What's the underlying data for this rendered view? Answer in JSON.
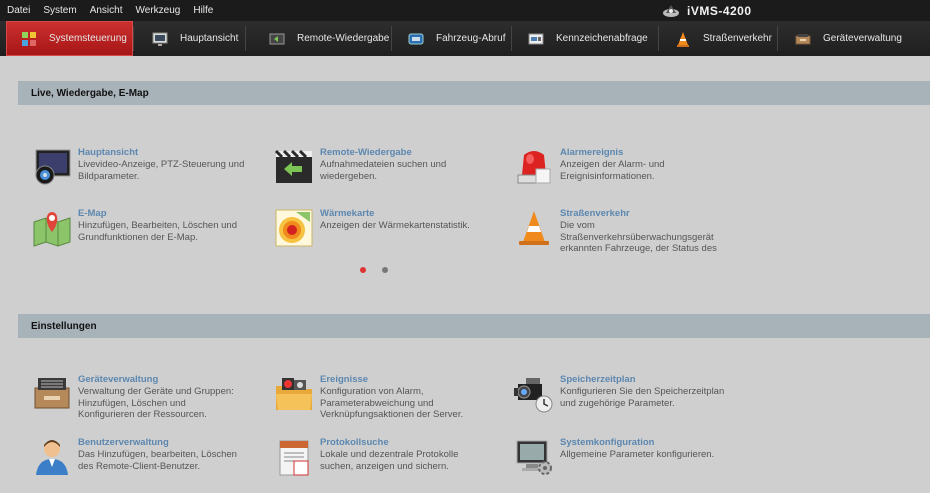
{
  "menubar": {
    "items": [
      "Datei",
      "System",
      "Ansicht",
      "Werkzeug",
      "Hilfe"
    ],
    "app_title": "iVMS-4200"
  },
  "tabs": [
    {
      "label": "Systemsteuerung",
      "icon": "grid-icon",
      "active": true
    },
    {
      "label": "Hauptansicht",
      "icon": "monitor-icon",
      "active": false
    },
    {
      "label": "Remote-Wiedergabe",
      "icon": "playback-icon",
      "active": false
    },
    {
      "label": "Fahrzeug-Abruf",
      "icon": "car-icon",
      "active": false
    },
    {
      "label": "Kennzeichenabfrage",
      "icon": "license-plate-icon",
      "active": false
    },
    {
      "label": "Straßenverkehr",
      "icon": "traffic-cone-icon",
      "active": false
    },
    {
      "label": "Geräteverwaltung",
      "icon": "device-icon",
      "active": false
    }
  ],
  "sections": {
    "live": {
      "header": "Live, Wiedergabe, E-Map",
      "items": [
        {
          "title": "Hauptansicht",
          "desc": [
            "Livevideo-Anzeige, PTZ-Steuerung und",
            "Bildparameter."
          ],
          "icon": "main-view-icon"
        },
        {
          "title": "Remote-Wiedergabe",
          "desc": [
            "Aufnahmedateien suchen und",
            "wiedergeben."
          ],
          "icon": "remote-playback-icon"
        },
        {
          "title": "Alarmereignis",
          "desc": [
            "Anzeigen der Alarm- und",
            "Ereignisinformationen."
          ],
          "icon": "alarm-icon"
        },
        {
          "title": "E-Map",
          "desc": [
            "Hinzufügen, Bearbeiten, Löschen und",
            "Grundfunktionen der E-Map."
          ],
          "icon": "emap-icon"
        },
        {
          "title": "Wärmekarte",
          "desc": [
            "Anzeigen der Wärmekartenstatistik."
          ],
          "icon": "heatmap-icon"
        },
        {
          "title": "Straßenverkehr",
          "desc": [
            "Die vom",
            "Straßenverkehrsüberwachungsgerät",
            "erkannten Fahrzeuge, der Status des"
          ],
          "icon": "traffic-cone-icon"
        }
      ]
    },
    "settings": {
      "header": "Einstellungen",
      "items": [
        {
          "title": "Geräteverwaltung",
          "desc": [
            "Verwaltung der Geräte und Gruppen:",
            "Hinzufügen, Löschen und",
            "Konfigurieren der Ressourcen."
          ],
          "icon": "device-management-icon"
        },
        {
          "title": "Ereignisse",
          "desc": [
            "Konfiguration von Alarm,",
            "Parameterabweichung und",
            "Verknüpfungsaktionen der Server."
          ],
          "icon": "events-folder-icon"
        },
        {
          "title": "Speicherzeitplan",
          "desc": [
            "Konfigurieren Sie den Speicherzeitplan",
            "und zugehörige Parameter."
          ],
          "icon": "camera-schedule-icon"
        },
        {
          "title": "Benutzerverwaltung",
          "desc": [
            "Das Hinzufügen, bearbeiten, Löschen",
            "des Remote-Client-Benutzer."
          ],
          "icon": "user-icon"
        },
        {
          "title": "Protokollsuche",
          "desc": [
            "Lokale und dezentrale Protokolle",
            "suchen, anzeigen und sichern."
          ],
          "icon": "log-calendar-icon"
        },
        {
          "title": "Systemkonfiguration",
          "desc": [
            "Allgemeine Parameter konfigurieren."
          ],
          "icon": "system-config-icon"
        }
      ]
    }
  },
  "pager": {
    "pages": 2,
    "current": 1
  },
  "colors": {
    "accent": "#b81f1f",
    "title_link": "#5c87b0",
    "section_header": "#a8b2b9"
  }
}
